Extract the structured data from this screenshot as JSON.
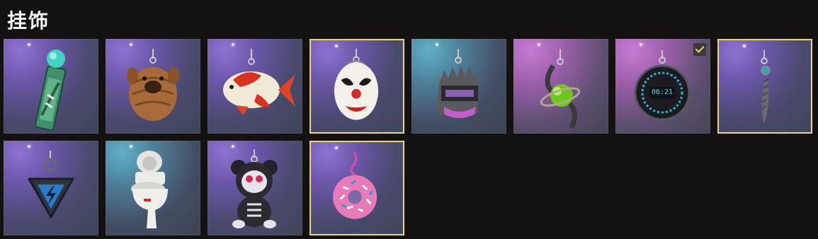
{
  "page": {
    "title": "挂饰"
  },
  "charms": [
    {
      "icon": "sponsor-stick-charm-icon",
      "background": "purple",
      "selected": false,
      "equipped": false
    },
    {
      "icon": "shar-pei-dog-charm-icon",
      "background": "purple",
      "selected": false,
      "equipped": false
    },
    {
      "icon": "koi-fish-charm-icon",
      "background": "purple",
      "selected": false,
      "equipped": false
    },
    {
      "icon": "clown-mask-charm-icon",
      "background": "purple",
      "selected": true,
      "equipped": false
    },
    {
      "icon": "spiked-helmet-charm-icon",
      "background": "blue",
      "selected": false,
      "equipped": false
    },
    {
      "icon": "green-orb-charm-icon",
      "background": "pink",
      "selected": false,
      "equipped": false
    },
    {
      "icon": "digital-clock-charm-icon",
      "background": "pink",
      "selected": false,
      "equipped": true,
      "clock_text": "06:21"
    },
    {
      "icon": "feather-charm-icon",
      "background": "purple",
      "selected": true,
      "equipped": false
    },
    {
      "icon": "lightning-triangle-charm-icon",
      "background": "purple",
      "selected": false,
      "equipped": false
    },
    {
      "icon": "toilet-charm-icon",
      "background": "blue",
      "selected": false,
      "equipped": false
    },
    {
      "icon": "sugar-skull-bear-charm-icon",
      "background": "purple",
      "selected": false,
      "equipped": false
    },
    {
      "icon": "pink-donut-charm-icon",
      "background": "purple",
      "selected": true,
      "equipped": false
    }
  ],
  "colors": {
    "page_background": "#141210",
    "selected_border": "#e7d27a",
    "title_text": "#f2f2f2"
  }
}
